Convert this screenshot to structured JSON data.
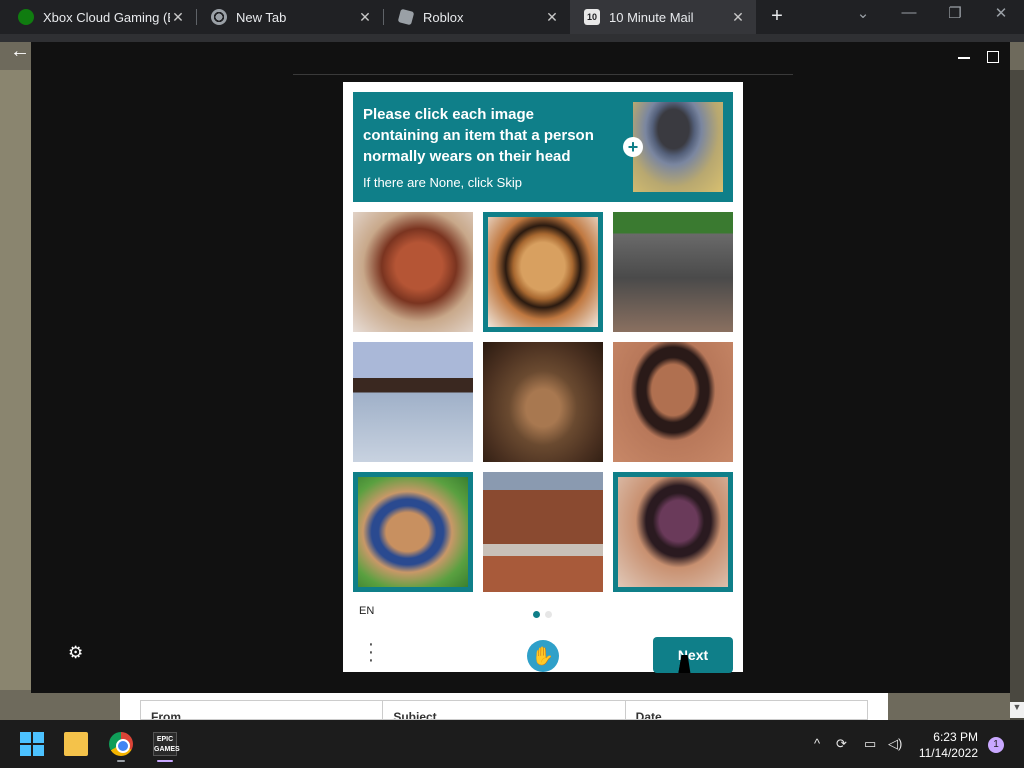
{
  "browser": {
    "tabs": [
      {
        "label": "Xbox Cloud Gaming (B",
        "favicon": "xbox-icon",
        "color": "#107c10"
      },
      {
        "label": "New Tab",
        "favicon": "chrome-icon",
        "color": "#9aa0a6"
      },
      {
        "label": "Roblox",
        "favicon": "roblox-icon",
        "color": "#9aa0a6"
      },
      {
        "label": "10 Minute Mail",
        "favicon": "ten-minute-mail-icon",
        "color": "#e8e8e8"
      }
    ],
    "active_tab": 3,
    "new_tab_glyph": "+"
  },
  "captcha": {
    "prompt": "Please click each image containing an item that a person normally wears on their head",
    "subprompt": "If there are None, click Skip",
    "example_image": "fedora-hat-example",
    "accent": "#0f7f89",
    "tiles": [
      {
        "subject": "leather-boot",
        "selected": false
      },
      {
        "subject": "fedora-hat",
        "selected": true
      },
      {
        "subject": "sneaker",
        "selected": false
      },
      {
        "subject": "belt-on-jeans",
        "selected": false
      },
      {
        "subject": "belt-buckle-blur",
        "selected": false
      },
      {
        "subject": "leather-belt-loop",
        "selected": false
      },
      {
        "subject": "straw-hat",
        "selected": true
      },
      {
        "subject": "belt-buckle",
        "selected": false
      },
      {
        "subject": "felt-hat",
        "selected": true
      }
    ],
    "language": "EN",
    "page_indicator": {
      "current": 1,
      "total": 2
    },
    "next_label": "Next"
  },
  "mail_table": {
    "columns": [
      "From",
      "Subject",
      "Date"
    ]
  },
  "taskbar": {
    "pinned": [
      "windows-start-icon",
      "file-explorer-icon",
      "chrome-icon",
      "epic-games-icon"
    ],
    "epic_label": "EPIC GAMES",
    "time": "6:23 PM",
    "date": "11/14/2022",
    "notification_count": "1"
  }
}
